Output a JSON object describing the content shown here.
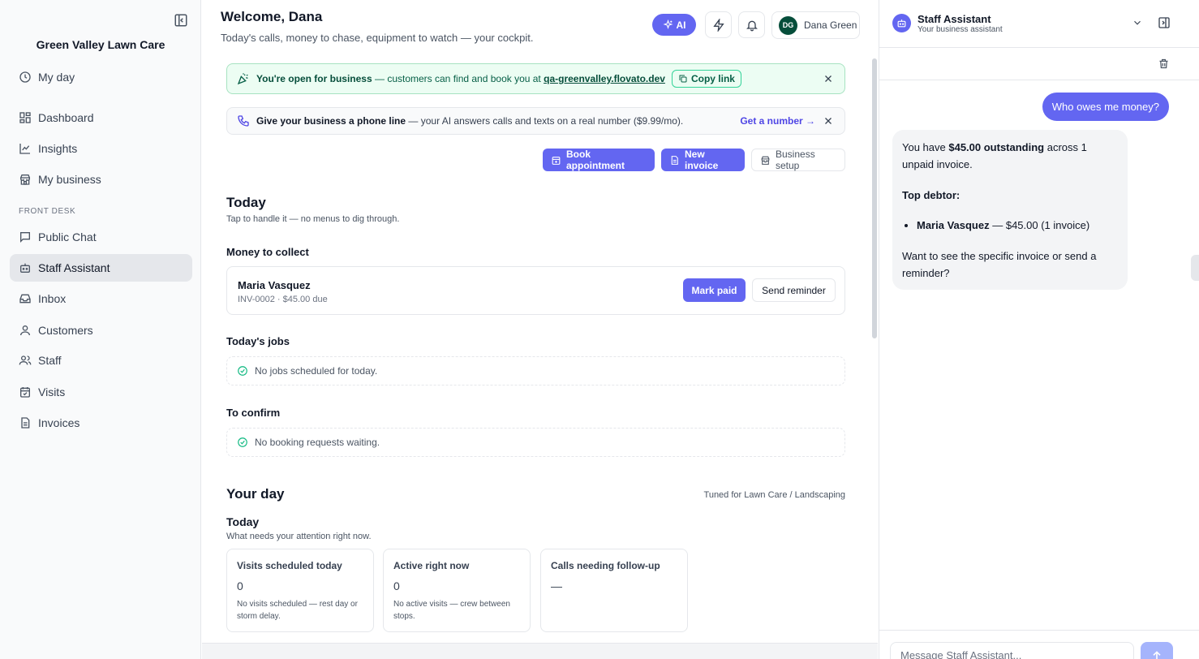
{
  "sidebar": {
    "brand": "Green Valley Lawn Care",
    "section_label": "FRONT DESK",
    "items": [
      {
        "label": "My day",
        "icon": "clock-icon"
      },
      {
        "label": "Dashboard",
        "icon": "dashboard-icon"
      },
      {
        "label": "Insights",
        "icon": "chart-line-icon"
      },
      {
        "label": "My business",
        "icon": "store-icon"
      },
      {
        "label": "Public Chat",
        "icon": "chat-icon"
      },
      {
        "label": "Staff Assistant",
        "icon": "bot-icon",
        "active": true
      },
      {
        "label": "Inbox",
        "icon": "inbox-icon"
      },
      {
        "label": "Customers",
        "icon": "user-icon"
      },
      {
        "label": "Staff",
        "icon": "users-icon"
      },
      {
        "label": "Visits",
        "icon": "calendar-check-icon"
      },
      {
        "label": "Invoices",
        "icon": "file-icon"
      }
    ]
  },
  "header": {
    "title": "Welcome, Dana",
    "subtitle": "Today's calls, money to chase, equipment to watch — your cockpit.",
    "ai_label": "AI",
    "user_initials": "DG",
    "user_name": "Dana Green"
  },
  "banners": {
    "open": {
      "title": "You're open for business",
      "text": " — customers can find and book you at ",
      "link": "qa-greenvalley.flovato.dev",
      "copy_label": "Copy link"
    },
    "phone": {
      "title": "Give your business a phone line",
      "text": " — your AI answers calls and texts on a real number ($9.99/mo).",
      "cta": "Get a number →"
    }
  },
  "actions": {
    "book": "Book appointment",
    "invoice": "New invoice",
    "setup": "Business setup"
  },
  "today": {
    "title": "Today",
    "subtitle": "Tap to handle it — no menus to dig through.",
    "money_title": "Money to collect",
    "money_item": {
      "name": "Maria Vasquez",
      "detail": "INV-0002 · $45.00 due",
      "mark_paid": "Mark paid",
      "send_reminder": "Send reminder"
    },
    "jobs_title": "Today's jobs",
    "jobs_empty": "No jobs scheduled for today.",
    "confirm_title": "To confirm",
    "confirm_empty": "No booking requests waiting."
  },
  "your_day": {
    "title": "Your day",
    "tuned": "Tuned for Lawn Care / Landscaping",
    "sub_title": "Today",
    "sub_desc": "What needs your attention right now.",
    "stats": [
      {
        "label": "Visits scheduled today",
        "value": "0",
        "desc": "No visits scheduled — rest day or storm delay."
      },
      {
        "label": "Active right now",
        "value": "0",
        "desc": "No active visits — crew between stops."
      },
      {
        "label": "Calls needing follow-up",
        "value": "—",
        "desc": ""
      }
    ]
  },
  "assistant": {
    "title": "Staff Assistant",
    "subtitle": "Your business assistant",
    "user_message": "Who owes me money?",
    "reply": {
      "p1_pre": "You have ",
      "p1_bold": "$45.00 outstanding",
      "p1_post": " across 1 unpaid invoice.",
      "top_label": "Top debtor:",
      "debtor_name": "Maria Vasquez",
      "debtor_detail": " — $45.00 (1 invoice)",
      "closing": "Want to see the specific invoice or send a reminder?"
    },
    "input_placeholder": "Message Staff Assistant..."
  },
  "colors": {
    "accent": "#6366f1",
    "success": "#10b981",
    "banner_green_bg": "#ecfdf3"
  }
}
